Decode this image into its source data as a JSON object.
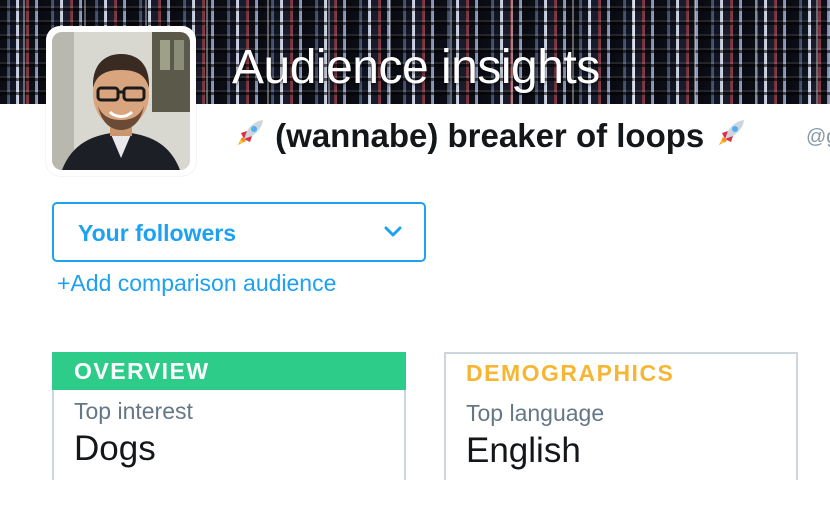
{
  "header": {
    "title": "Audience insights",
    "display_name": "(wannabe) breaker of loops",
    "handle": "@g"
  },
  "audience_selector": {
    "selected": "Your followers",
    "add_comparison": "+Add comparison audience"
  },
  "cards": {
    "overview": {
      "heading": "OVERVIEW",
      "label": "Top interest",
      "value": "Dogs",
      "color": "#2ecc89"
    },
    "demographics": {
      "heading": "DEMOGRAPHICS",
      "label": "Top language",
      "value": "English",
      "color": "#f5b733"
    }
  },
  "icons": {
    "name_prefix": "rocket-icon",
    "name_suffix": "rocket-icon",
    "dropdown": "chevron-down-icon"
  },
  "colors": {
    "accent": "#1da1f2",
    "text": "#14171a",
    "muted": "#657786"
  }
}
